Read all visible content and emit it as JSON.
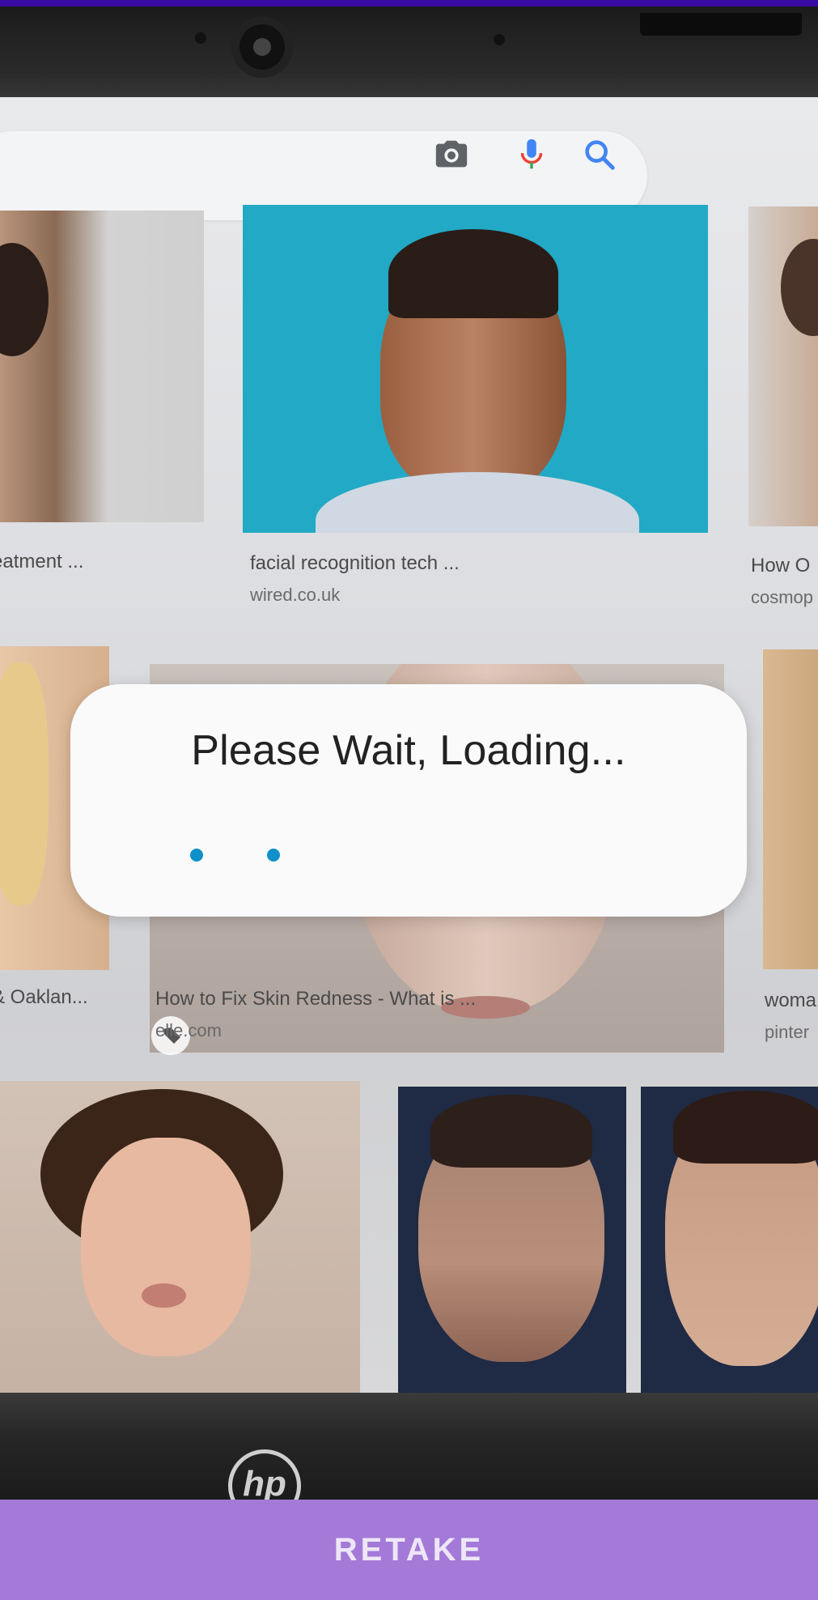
{
  "camera_preview": {
    "search_icons": [
      "camera-icon",
      "mic-icon",
      "search-icon"
    ],
    "results_row1": [
      {
        "caption": "eatment ...",
        "source": ""
      },
      {
        "caption": "facial recognition tech ...",
        "source": "wired.co.uk"
      },
      {
        "caption": "How O",
        "source": "cosmop"
      }
    ],
    "results_row2": [
      {
        "caption": "& Oaklan...",
        "source": ""
      },
      {
        "caption": "How to Fix Skin Redness - What is ...",
        "source": "elle.com"
      },
      {
        "caption": "woma",
        "source": "pinter"
      }
    ],
    "laptop_logo": "hp"
  },
  "dialog": {
    "title": "Please Wait, Loading..."
  },
  "actions": {
    "retake_label": "RETAKE"
  },
  "colors": {
    "accent_button": "#a47ad8",
    "loader_dot": "#0e90c9",
    "status_strip": "#3a0ca3"
  }
}
